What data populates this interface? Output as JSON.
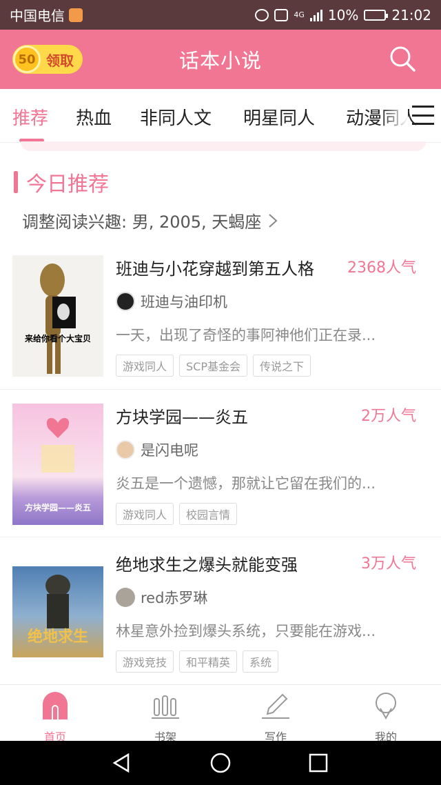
{
  "status_bar": {
    "carrier": "中国电信",
    "network": "4G",
    "battery": "10%",
    "time": "21:02"
  },
  "header": {
    "reward_coins": "50",
    "reward_label": "领取",
    "title": "话本小说"
  },
  "tabs": [
    {
      "label": "推荐",
      "active": true
    },
    {
      "label": "热血",
      "active": false
    },
    {
      "label": "非同人文",
      "active": false
    },
    {
      "label": "明星同人",
      "active": false
    },
    {
      "label": "动漫同人",
      "active": false
    }
  ],
  "section": {
    "title": "今日推荐",
    "interest": "调整阅读兴趣: 男, 2005, 天蝎座"
  },
  "books": [
    {
      "title": "班迪与小花穿越到第五人格",
      "popularity": "2368人气",
      "author": "班迪与油印机",
      "description": "一天，出现了奇怪的事阿神他们正在录...",
      "tags": [
        "游戏同人",
        "SCP基金会",
        "传说之下"
      ],
      "cover_caption": "来给你看个大宝贝"
    },
    {
      "title": "方块学园——炎五",
      "popularity": "2万人气",
      "author": "是闪电呢",
      "description": "炎五是一个遗憾，那就让它留在我们的...",
      "tags": [
        "游戏同人",
        "校园言情"
      ],
      "cover_caption": "方块学园——炎五"
    },
    {
      "title": "绝地求生之爆头就能变强",
      "popularity": "3万人气",
      "author": "red赤罗琳",
      "description": "林星意外捡到爆头系统，只要能在游戏...",
      "tags": [
        "游戏竞技",
        "和平精英",
        "系统"
      ],
      "cover_caption": "绝地求生"
    }
  ],
  "bottom_nav": [
    {
      "label": "首页",
      "icon": "home-icon",
      "active": true
    },
    {
      "label": "书架",
      "icon": "bookshelf-icon",
      "active": false
    },
    {
      "label": "写作",
      "icon": "pen-icon",
      "active": false
    },
    {
      "label": "我的",
      "icon": "profile-icon",
      "active": false
    }
  ],
  "colors": {
    "accent": "#f07694",
    "status_bar": "#5a3a3d",
    "coin": "#ffd94a"
  }
}
